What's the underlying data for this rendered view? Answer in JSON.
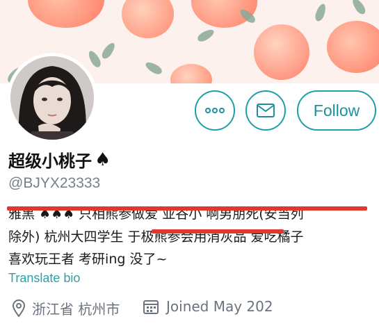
{
  "profile": {
    "display_name": "超级小桃子",
    "name_badge_icon": "spade-icon",
    "handle": "@BJYX23333",
    "avatar_icon": "profile-photo"
  },
  "actions": {
    "more_icon": "more-horizontal-icon",
    "message_icon": "envelope-icon",
    "follow_label": "Follow"
  },
  "bio": {
    "line1": "雅黑 ♠♠♠ 只相熊参做爱 亚谷小 啊男朋死(安当列",
    "line2": "除外)  杭州大四学生  于极熊参会用消灰品 爱吃橘子",
    "line3": "喜欢玩王者  考研ing   没了~",
    "translate_label": "Translate bio"
  },
  "meta": {
    "location_icon": "location-pin-icon",
    "location": "浙江省 杭州市",
    "calendar_icon": "calendar-icon",
    "joined": "Joined May 202"
  },
  "colors": {
    "accent": "#1ba0a6",
    "redaction": "#e3362c",
    "banner_bg": "#fcf1ec"
  }
}
